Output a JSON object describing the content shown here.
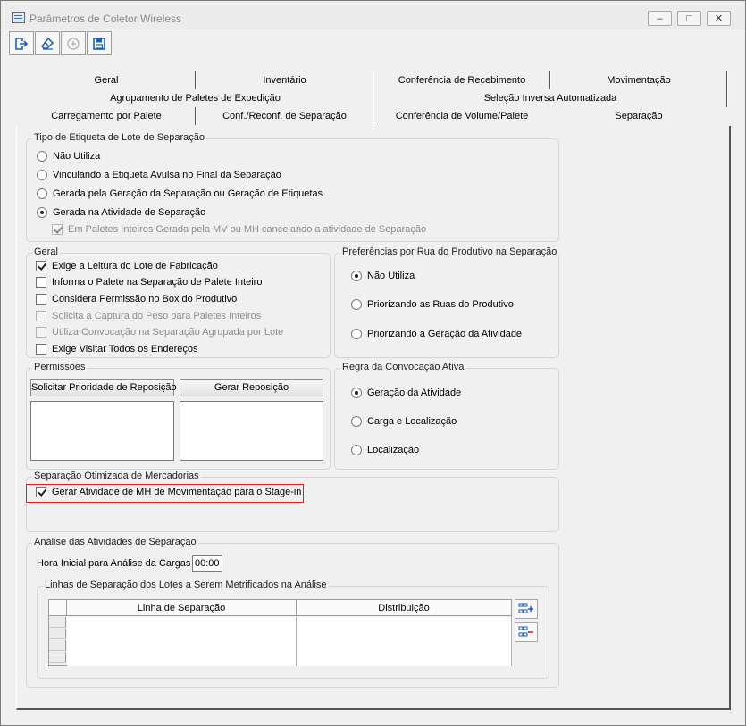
{
  "window": {
    "title": "Parâmetros de Coletor Wireless",
    "controls": {
      "minimize": "–",
      "maximize": "□",
      "close": "✕"
    }
  },
  "toolbar": {
    "buttons": [
      {
        "icon": "exit-icon"
      },
      {
        "icon": "eraser-icon"
      },
      {
        "icon": "add-icon",
        "disabled": true
      },
      {
        "icon": "save-icon"
      }
    ]
  },
  "tabs": {
    "row1": [
      "Geral",
      "Inventário",
      "Conferência de Recebimento",
      "Movimentação"
    ],
    "row2": [
      "Agrupamento de Paletes de Expedição",
      "Seleção Inversa Automatizada"
    ],
    "row3": [
      "Carregamento por Palete",
      "Conf./Reconf. de Separação",
      "Conferência de Volume/Palete",
      "Separação"
    ],
    "active": "Separação"
  },
  "tipo_etiqueta": {
    "legend": "Tipo de Etiqueta de Lote de Separação",
    "options": [
      {
        "label": "Não Utiliza",
        "selected": false
      },
      {
        "label": "Vinculando a Etiqueta Avulsa no Final da Separação",
        "selected": false
      },
      {
        "label": "Gerada pela Geração da Separação ou Geração de Etiquetas",
        "selected": false
      },
      {
        "label": "Gerada na Atividade de Separação",
        "selected": true
      }
    ],
    "sub_check": {
      "label": "Em Paletes Inteiros Gerada pela MV ou MH cancelando a atividade de Separação",
      "checked": true,
      "disabled": true
    }
  },
  "geral": {
    "legend": "Geral",
    "checks": [
      {
        "label": "Exige a Leitura do Lote de Fabricação",
        "checked": true,
        "disabled": false
      },
      {
        "label": "Informa o Palete na Separação de Palete Inteiro",
        "checked": false,
        "disabled": false
      },
      {
        "label": "Considera Permissão no Box do Produtivo",
        "checked": false,
        "disabled": false
      },
      {
        "label": "Solicita a Captura do Peso para Paletes Inteiros",
        "checked": false,
        "disabled": true
      },
      {
        "label": "Utiliza Convocação na Separação Agrupada por Lote",
        "checked": false,
        "disabled": true
      },
      {
        "label": "Exige Visitar Todos os Endereços",
        "checked": false,
        "disabled": false
      }
    ]
  },
  "preferencias": {
    "legend": "Preferências por Rua do Produtivo na Separação",
    "options": [
      {
        "label": "Não Utiliza",
        "selected": true
      },
      {
        "label": "Priorizando as Ruas do Produtivo",
        "selected": false
      },
      {
        "label": "Priorizando a Geração da Atividade",
        "selected": false
      }
    ]
  },
  "permissoes": {
    "legend": "Permissões",
    "button_left": "Solicitar Prioridade de Reposição",
    "button_right": "Gerar Reposição"
  },
  "regra": {
    "legend": "Regra da Convocação Ativa",
    "options": [
      {
        "label": "Geração da Atividade",
        "selected": true
      },
      {
        "label": "Carga e Localização",
        "selected": false
      },
      {
        "label": "Localização",
        "selected": false
      }
    ]
  },
  "otimizada": {
    "legend": "Separação Otimizada de Mercadorias",
    "check": {
      "label": "Gerar Atividade de MH de Movimentação para o Stage-in",
      "checked": true
    }
  },
  "analise": {
    "legend": "Análise das Atividades de Separação",
    "hora_label": "Hora Inicial para Análise da Cargas",
    "hora_value": "00:00",
    "linhas_legend": "Linhas de Separação dos Lotes a Serem Metrificados na Análise",
    "columns": [
      "Linha de Separação",
      "Distribuição"
    ],
    "add_icon": "add-row-icon",
    "remove_icon": "remove-row-icon"
  },
  "colors": {
    "highlight": "#e02020",
    "window_bg": "#f0f0f0"
  }
}
